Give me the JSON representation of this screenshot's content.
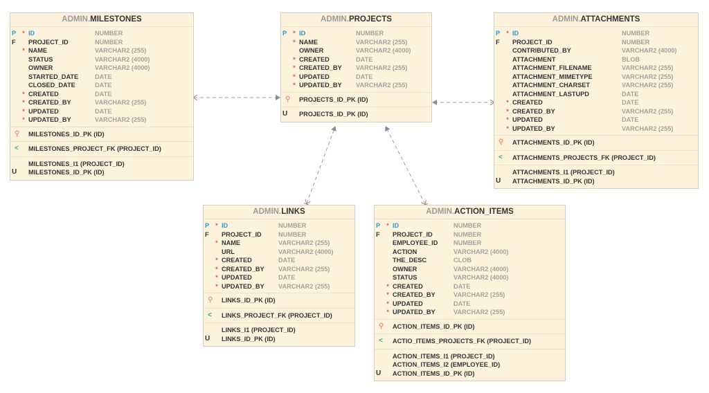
{
  "diagram": {
    "colors": {
      "entity_fill": "#fdf3dc",
      "entity_border": "#d4cfc2",
      "pk_blue": "#2a9ad6",
      "required_red": "#e0554f",
      "type_gray": "#a5a29b",
      "pk_key_orange": "#e89a6a",
      "fk_green": "#3aab6a",
      "connector": "#8c8c8c"
    },
    "entities": [
      {
        "id": "milestones",
        "schema": "ADMIN.",
        "name": "MILESTONES",
        "columns": [
          {
            "flag": "P",
            "required": true,
            "name": "ID",
            "type": "NUMBER"
          },
          {
            "flag": "F",
            "required": false,
            "name": "PROJECT_ID",
            "type": "NUMBER"
          },
          {
            "flag": "",
            "required": true,
            "name": "NAME",
            "type": "VARCHAR2 (255)"
          },
          {
            "flag": "",
            "required": false,
            "name": "STATUS",
            "type": "VARCHAR2 (4000)"
          },
          {
            "flag": "",
            "required": false,
            "name": "OWNER",
            "type": "VARCHAR2 (4000)"
          },
          {
            "flag": "",
            "required": false,
            "name": "STARTED_DATE",
            "type": "DATE"
          },
          {
            "flag": "",
            "required": false,
            "name": "CLOSED_DATE",
            "type": "DATE"
          },
          {
            "flag": "",
            "required": true,
            "name": "CREATED",
            "type": "DATE"
          },
          {
            "flag": "",
            "required": true,
            "name": "CREATED_BY",
            "type": "VARCHAR2 (255)"
          },
          {
            "flag": "",
            "required": true,
            "name": "UPDATED",
            "type": "DATE"
          },
          {
            "flag": "",
            "required": true,
            "name": "UPDATED_BY",
            "type": "VARCHAR2 (255)"
          }
        ],
        "pk": [
          "MILESTONES_ID_PK (ID)"
        ],
        "fk": [
          "MILESTONES_PROJECT_FK (PROJECT_ID)"
        ],
        "indexes": [
          {
            "flag": "",
            "name": "MILESTONES_I1 (PROJECT_ID)"
          },
          {
            "flag": "U",
            "name": "MILESTONES_ID_PK (ID)"
          }
        ]
      },
      {
        "id": "projects",
        "schema": "ADMIN.",
        "name": "PROJECTS",
        "columns": [
          {
            "flag": "P",
            "required": true,
            "name": "ID",
            "type": "NUMBER"
          },
          {
            "flag": "",
            "required": true,
            "name": "NAME",
            "type": "VARCHAR2 (255)"
          },
          {
            "flag": "",
            "required": false,
            "name": "OWNER",
            "type": "VARCHAR2 (4000)"
          },
          {
            "flag": "",
            "required": true,
            "name": "CREATED",
            "type": "DATE"
          },
          {
            "flag": "",
            "required": true,
            "name": "CREATED_BY",
            "type": "VARCHAR2 (255)"
          },
          {
            "flag": "",
            "required": true,
            "name": "UPDATED",
            "type": "DATE"
          },
          {
            "flag": "",
            "required": true,
            "name": "UPDATED_BY",
            "type": "VARCHAR2 (255)"
          }
        ],
        "pk": [
          "PROJECTS_ID_PK (ID)"
        ],
        "fk": [],
        "indexes": [
          {
            "flag": "U",
            "name": "PROJECTS_ID_PK (ID)"
          }
        ]
      },
      {
        "id": "attachments",
        "schema": "ADMIN.",
        "name": "ATTACHMENTS",
        "columns": [
          {
            "flag": "P",
            "required": true,
            "name": "ID",
            "type": "NUMBER"
          },
          {
            "flag": "F",
            "required": false,
            "name": "PROJECT_ID",
            "type": "NUMBER"
          },
          {
            "flag": "",
            "required": false,
            "name": "CONTRIBUTED_BY",
            "type": "VARCHAR2 (4000)"
          },
          {
            "flag": "",
            "required": false,
            "name": "ATTACHMENT",
            "type": "BLOB"
          },
          {
            "flag": "",
            "required": false,
            "name": "ATTACHMENT_FILENAME",
            "type": "VARCHAR2 (255)"
          },
          {
            "flag": "",
            "required": false,
            "name": "ATTACHMENT_MIMETYPE",
            "type": "VARCHAR2 (255)"
          },
          {
            "flag": "",
            "required": false,
            "name": "ATTACHMENT_CHARSET",
            "type": "VARCHAR2 (255)"
          },
          {
            "flag": "",
            "required": false,
            "name": "ATTACHMENT_LASTUPD",
            "type": "DATE"
          },
          {
            "flag": "",
            "required": true,
            "name": "CREATED",
            "type": "DATE"
          },
          {
            "flag": "",
            "required": true,
            "name": "CREATED_BY",
            "type": "VARCHAR2 (255)"
          },
          {
            "flag": "",
            "required": true,
            "name": "UPDATED",
            "type": "DATE"
          },
          {
            "flag": "",
            "required": true,
            "name": "UPDATED_BY",
            "type": "VARCHAR2 (255)"
          }
        ],
        "pk": [
          "ATTACHMENTS_ID_PK (ID)"
        ],
        "fk": [
          "ATTACHMENTS_PROJECTS_FK (PROJECT_ID)"
        ],
        "indexes": [
          {
            "flag": "",
            "name": "ATTACHMENTS_I1 (PROJECT_ID)"
          },
          {
            "flag": "U",
            "name": "ATTACHMENTS_ID_PK (ID)"
          }
        ]
      },
      {
        "id": "links",
        "schema": "ADMIN.",
        "name": "LINKS",
        "columns": [
          {
            "flag": "P",
            "required": true,
            "name": "ID",
            "type": "NUMBER"
          },
          {
            "flag": "F",
            "required": false,
            "name": "PROJECT_ID",
            "type": "NUMBER"
          },
          {
            "flag": "",
            "required": true,
            "name": "NAME",
            "type": "VARCHAR2 (255)"
          },
          {
            "flag": "",
            "required": false,
            "name": "URL",
            "type": "VARCHAR2 (4000)"
          },
          {
            "flag": "",
            "required": true,
            "name": "CREATED",
            "type": "DATE"
          },
          {
            "flag": "",
            "required": true,
            "name": "CREATED_BY",
            "type": "VARCHAR2 (255)"
          },
          {
            "flag": "",
            "required": true,
            "name": "UPDATED",
            "type": "DATE"
          },
          {
            "flag": "",
            "required": true,
            "name": "UPDATED_BY",
            "type": "VARCHAR2 (255)"
          }
        ],
        "pk": [
          "LINKS_ID_PK (ID)"
        ],
        "fk": [
          "LINKS_PROJECT_FK (PROJECT_ID)"
        ],
        "indexes": [
          {
            "flag": "",
            "name": "LINKS_I1 (PROJECT_ID)"
          },
          {
            "flag": "U",
            "name": "LINKS_ID_PK (ID)"
          }
        ]
      },
      {
        "id": "action_items",
        "schema": "ADMIN.",
        "name": "ACTION_ITEMS",
        "columns": [
          {
            "flag": "P",
            "required": true,
            "name": "ID",
            "type": "NUMBER"
          },
          {
            "flag": "F",
            "required": false,
            "name": "PROJECT_ID",
            "type": "NUMBER"
          },
          {
            "flag": "",
            "required": false,
            "name": "EMPLOYEE_ID",
            "type": "NUMBER"
          },
          {
            "flag": "",
            "required": false,
            "name": "ACTION",
            "type": "VARCHAR2 (4000)"
          },
          {
            "flag": "",
            "required": false,
            "name": "THE_DESC",
            "type": "CLOB"
          },
          {
            "flag": "",
            "required": false,
            "name": "OWNER",
            "type": "VARCHAR2 (4000)"
          },
          {
            "flag": "",
            "required": false,
            "name": "STATUS",
            "type": "VARCHAR2 (4000)"
          },
          {
            "flag": "",
            "required": true,
            "name": "CREATED",
            "type": "DATE"
          },
          {
            "flag": "",
            "required": true,
            "name": "CREATED_BY",
            "type": "VARCHAR2 (255)"
          },
          {
            "flag": "",
            "required": true,
            "name": "UPDATED",
            "type": "DATE"
          },
          {
            "flag": "",
            "required": true,
            "name": "UPDATED_BY",
            "type": "VARCHAR2 (255)"
          }
        ],
        "pk": [
          "ACTION_ITEMS_ID_PK (ID)"
        ],
        "fk": [
          "ACTIO_ITEMS_PROJECTS_FK (PROJECT_ID)"
        ],
        "indexes": [
          {
            "flag": "",
            "name": "ACTION_ITEMS_I1 (PROJECT_ID)"
          },
          {
            "flag": "",
            "name": "ACTION_ITEMS_I2 (EMPLOYEE_ID)"
          },
          {
            "flag": "U",
            "name": "ACTION_ITEMS_ID_PK (ID)"
          }
        ]
      }
    ],
    "relationships": [
      {
        "from": "milestones",
        "to": "projects",
        "style": "dashed"
      },
      {
        "from": "attachments",
        "to": "projects",
        "style": "dashed"
      },
      {
        "from": "links",
        "to": "projects",
        "style": "dashed"
      },
      {
        "from": "action_items",
        "to": "projects",
        "style": "dashed"
      }
    ],
    "icons": {
      "pk_key": "key-icon",
      "fk_share": "share-icon",
      "required": "asterisk"
    }
  }
}
